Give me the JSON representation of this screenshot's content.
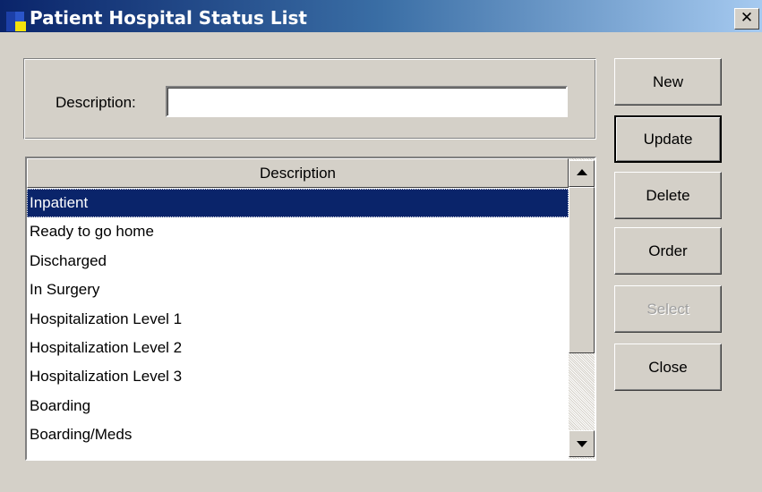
{
  "window": {
    "title": "Patient Hospital Status List",
    "close_glyph": "✕"
  },
  "form": {
    "description_label": "Description:",
    "description_value": "",
    "description_placeholder": ""
  },
  "list": {
    "column_header": "Description",
    "selected_index": 0,
    "items": [
      "Inpatient",
      "Ready to go home",
      "Discharged",
      "In Surgery",
      "Hospitalization Level 1",
      "Hospitalization Level 2",
      "Hospitalization Level 3",
      "Boarding",
      "Boarding/Meds"
    ]
  },
  "buttons": {
    "new": "New",
    "update": "Update",
    "delete": "Delete",
    "order": "Order",
    "select": "Select",
    "close": "Close"
  },
  "icons": {
    "app": "app-icon",
    "close": "close-icon",
    "scroll_up": "scroll-up-arrow-icon",
    "scroll_down": "scroll-down-arrow-icon"
  },
  "colors": {
    "selection": "#0a246a",
    "face": "#d4d0c8",
    "title_start": "#0a246a",
    "title_end": "#a6caf0",
    "disabled_text": "#a0a0a0"
  }
}
